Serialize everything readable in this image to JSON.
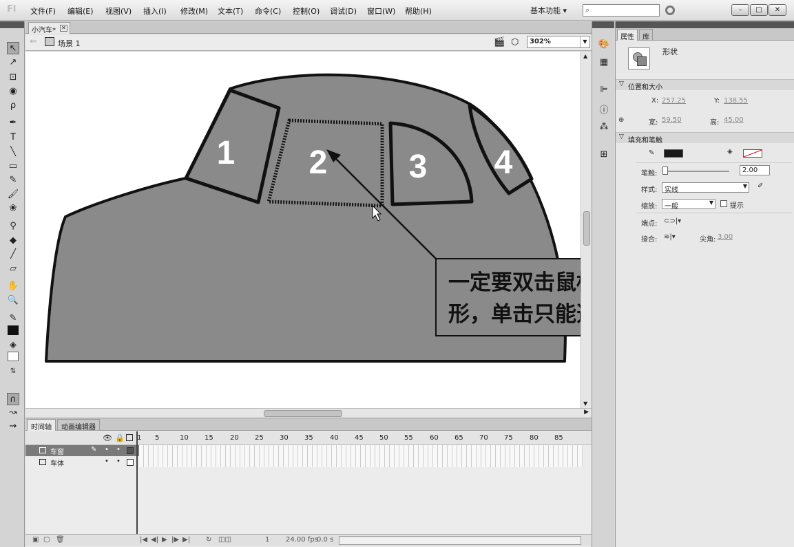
{
  "app": {
    "logo": "Fl"
  },
  "menu": [
    {
      "label": "文件(F)"
    },
    {
      "label": "编辑(E)"
    },
    {
      "label": "视图(V)"
    },
    {
      "label": "插入(I)"
    },
    {
      "label": "修改(M)"
    },
    {
      "label": "文本(T)"
    },
    {
      "label": "命令(C)"
    },
    {
      "label": "控制(O)"
    },
    {
      "label": "调试(D)"
    },
    {
      "label": "窗口(W)"
    },
    {
      "label": "帮助(H)"
    }
  ],
  "workspace": {
    "label": "基本功能 ▾"
  },
  "search": {
    "icon": "search-icon",
    "value": ""
  },
  "document": {
    "tab_label": "小汽车*",
    "scene_label": "场景 1",
    "zoom": "302%"
  },
  "stage": {
    "window_labels": [
      "1",
      "2",
      "3",
      "4"
    ],
    "callout_line1": "一定要双击鼠标才能全选整个图",
    "callout_line2": "形，单击只能选择其中某条线段",
    "fill_color": "#8a8a8a",
    "stroke_color": "#111111"
  },
  "timeline": {
    "tabs": [
      "时间轴",
      "动画编辑器"
    ],
    "frame_numbers": [
      "1",
      "5",
      "10",
      "15",
      "20",
      "25",
      "30",
      "35",
      "40",
      "45",
      "50",
      "55",
      "60",
      "65",
      "70",
      "75",
      "80",
      "85"
    ],
    "layers": [
      {
        "name": "车窗",
        "active": true
      },
      {
        "name": "车体",
        "active": false
      }
    ],
    "status": {
      "frame": "1",
      "fps": "24.00 fps",
      "time": "0.0 s"
    }
  },
  "properties": {
    "tabs": [
      "属性",
      "库"
    ],
    "object_type": "形状",
    "position_section": "位置和大小",
    "x_label": "X:",
    "x_value": "257.25",
    "y_label": "Y:",
    "y_value": "138.55",
    "w_label": "宽:",
    "w_value": "59.50",
    "h_label": "高:",
    "h_value": "45.00",
    "fill_section": "填充和笔触",
    "stroke_color": "#1a1a1a",
    "stroke_width_label": "笔触:",
    "stroke_width": "2.00",
    "style_label": "样式:",
    "style_value": "实线",
    "scale_label": "缩放:",
    "scale_value": "一般",
    "hint_label": "提示",
    "cap_label": "端点:",
    "join_label": "接合:",
    "miter_label": "尖角:",
    "miter_value": "3.00"
  }
}
